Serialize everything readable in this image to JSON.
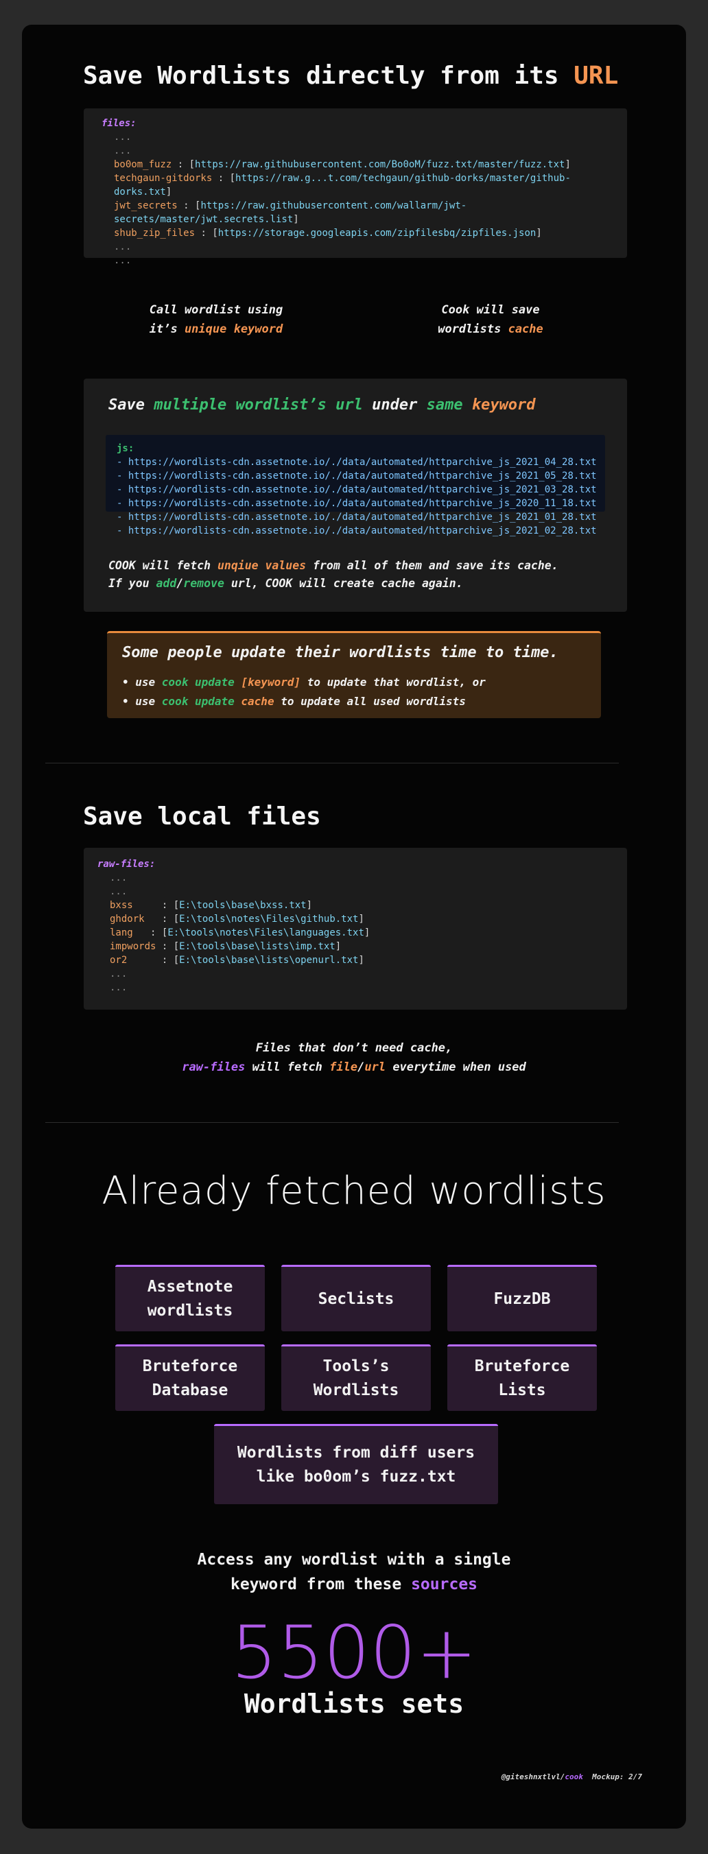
{
  "section1": {
    "title_main": "Save Wordlists directly from its ",
    "title_accent": "URL",
    "code_key": "files:",
    "ellipsis": "...",
    "entries": [
      {
        "name": "bo0om_fuzz",
        "sep": " : ",
        "url": "https://raw.githubusercontent.com/Bo0oM/fuzz.txt/master/fuzz.txt"
      },
      {
        "name": "techgaun-gitdorks",
        "sep": " : ",
        "url": "https://raw.g...t.com/techgaun/github-dorks/master/github-dorks.txt"
      },
      {
        "name": "jwt_secrets",
        "sep": " : ",
        "url": "https://raw.githubusercontent.com/wallarm/jwt-secrets/master/jwt.secrets.list"
      },
      {
        "name": "shub_zip_files",
        "sep": "  : ",
        "url": "https://storage.googleapis.com/zipfilesbq/zipfiles.json"
      }
    ],
    "caption_left_1": "Call wordlist using",
    "caption_left_2a": "it’s ",
    "caption_left_2b": "unique keyword",
    "caption_right_1": "Cook will save",
    "caption_right_2a": "wordlists ",
    "caption_right_2b": "cache"
  },
  "section2": {
    "t1": "Save ",
    "t2": "multiple wordlist’s url",
    "t3": " under ",
    "t4": "same",
    "t5": " keyword",
    "code_key": "js:",
    "urls": [
      "- https://wordlists-cdn.assetnote.io/./data/automated/httparchive_js_2021_04_28.txt",
      "- https://wordlists-cdn.assetnote.io/./data/automated/httparchive_js_2021_05_28.txt",
      "- https://wordlists-cdn.assetnote.io/./data/automated/httparchive_js_2021_03_28.txt",
      "- https://wordlists-cdn.assetnote.io/./data/automated/httparchive_js_2020_11_18.txt",
      "- https://wordlists-cdn.assetnote.io/./data/automated/httparchive_js_2021_01_28.txt",
      "- https://wordlists-cdn.assetnote.io/./data/automated/httparchive_js_2021_02_28.txt"
    ],
    "note1a": "COOK will fetch ",
    "note1b": "unqiue values",
    "note1c": " from all of them and save its cache.",
    "note2a": "If you ",
    "note2b": "add",
    "note2c": "/",
    "note2d": "remove",
    "note2e": " url, COOK will create cache again."
  },
  "warning": {
    "title": "Some people update their wordlists time to time.",
    "b1a": "• use ",
    "b1b": "cook update",
    "b1c": "[keyword]",
    "b1d": " to update that wordlist, or",
    "b2a": "• use ",
    "b2b": "cook update",
    "b2c": "cache",
    "b2d": " to update all used wordlists"
  },
  "section3": {
    "title": "Save local files",
    "code_key": "raw-files:",
    "ellipsis": "...",
    "entries": [
      {
        "name": "bxss",
        "sep": "     : ",
        "path": "E:\\tools\\base\\bxss.txt"
      },
      {
        "name": "ghdork",
        "sep": "   : ",
        "path": "E:\\tools\\notes\\Files\\github.txt"
      },
      {
        "name": "lang",
        "sep": "   : ",
        "path": "E:\\tools\\notes\\Files\\languages.txt"
      },
      {
        "name": "impwords",
        "sep": " : ",
        "path": "E:\\tools\\base\\lists\\imp.txt"
      },
      {
        "name": "or2",
        "sep": "      : ",
        "path": "E:\\tools\\base\\lists\\openurl.txt"
      }
    ],
    "caption1": "Files that don’t need cache,",
    "caption2a": "raw-files",
    "caption2b": " will fetch ",
    "caption2c": "file",
    "caption2d": "/",
    "caption2e": "url",
    "caption2f": " everytime when used"
  },
  "section4": {
    "title": "Already fetched wordlists",
    "cards": [
      "Assetnote wordlists",
      "Seclists",
      "FuzzDB",
      "Bruteforce Database",
      "Tools’s Wordlists",
      "Bruteforce Lists"
    ],
    "wide_card_1": "Wordlists from diff users",
    "wide_card_2": "like bo0om’s fuzz.txt",
    "access1": "Access any wordlist with a single",
    "access2a": "keyword from these ",
    "access2b": "sources",
    "count": "5500+",
    "count_label": "Wordlists sets",
    "footer_handle": "@giteshnxtlvl/",
    "footer_cook": "cook",
    "footer_mockup": "  Mockup: 2/7"
  },
  "colors": {
    "accent_orange": "#f59552",
    "accent_purple": "#b86bff",
    "accent_green": "#3cc070",
    "link_blue": "#7ed3f0"
  }
}
